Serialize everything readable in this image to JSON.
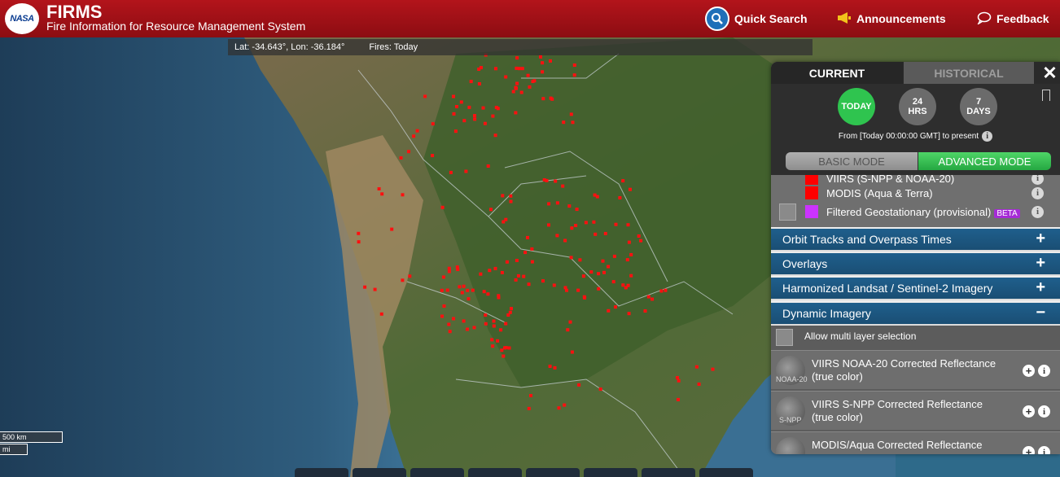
{
  "header": {
    "logo_text": "NASA",
    "title": "FIRMS",
    "subtitle": "Fire Information for Resource Management System",
    "quick_search": "Quick Search",
    "announcements": "Announcements",
    "feedback": "Feedback"
  },
  "status_bar": {
    "coords": "Lat: -34.643°, Lon: -36.184°",
    "fires": "Fires: Today"
  },
  "scale": {
    "km": "500 km",
    "mi": "mi"
  },
  "panel": {
    "tabs": {
      "current": "CURRENT",
      "historical": "HISTORICAL"
    },
    "close": "✕",
    "time_buttons": [
      {
        "line1": "TODAY",
        "line2": ""
      },
      {
        "line1": "24",
        "line2": "HRS"
      },
      {
        "line1": "7",
        "line2": "DAYS"
      }
    ],
    "from_text": "From [Today 00:00:00 GMT] to present",
    "info_glyph": "i",
    "modes": {
      "basic": "BASIC MODE",
      "advanced": "ADVANCED MODE"
    },
    "layers": [
      {
        "label": "VIIRS (S-NPP & NOAA-20)",
        "color": "#ff0000"
      },
      {
        "label": "MODIS (Aqua & Terra)",
        "color": "#ff0000"
      },
      {
        "label": "Filtered Geostationary (provisional)",
        "color": "#cc33ff",
        "badge": "BETA"
      }
    ],
    "sections": [
      {
        "label": "Orbit Tracks and Overpass Times",
        "sign": "+"
      },
      {
        "label": "Overlays",
        "sign": "+"
      },
      {
        "label": "Harmonized Landsat / Sentinel-2 Imagery",
        "sign": "+"
      },
      {
        "label": "Dynamic Imagery",
        "sign": "−"
      }
    ],
    "multi_layer": "Allow multi layer selection",
    "imagery": [
      {
        "title": "VIIRS NOAA-20 Corrected Reflectance (true color)",
        "thumb": "NOAA-20"
      },
      {
        "title": "VIIRS S-NPP Corrected Reflectance (true color)",
        "thumb": "S-NPP"
      },
      {
        "title": "MODIS/Aqua Corrected Reflectance",
        "thumb": ""
      }
    ]
  },
  "colors": {
    "brand_red": "#a3111a",
    "fire": "#ff0000",
    "active_green": "#2fc44f",
    "section_blue": "#1f5f8c"
  }
}
